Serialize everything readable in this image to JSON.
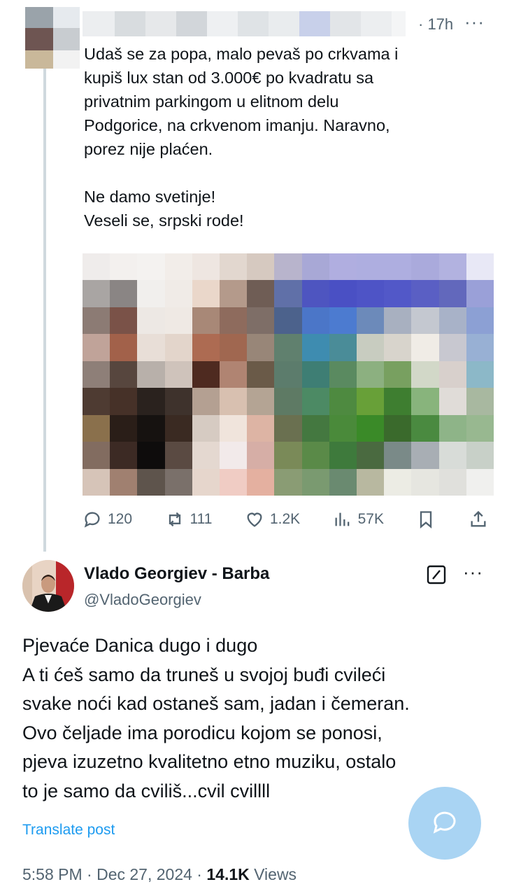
{
  "top_tweet": {
    "time": "· 17h",
    "more_icon": "more-horizontal-icon",
    "text": "Udaš se za popa, malo pevaš po crkvama i\nkupiš lux stan od 3.000€ po kvadratu sa\nprivatnim parkingom u elitnom delu\nPodgorice, na crkvenom imanju. Naravno,\nporez nije plaćen.\n\nNe damo svetinje!\nVeseli se, srpski rode!",
    "actions": {
      "replies": "120",
      "reposts": "111",
      "likes": "1.2K",
      "views": "57K"
    }
  },
  "reply": {
    "name": "Vlado Georgiev - Barba",
    "handle": "@VladoGeorgiev",
    "text": "Pjevaće Danica dugo i dugo\nA ti ćeš samo da truneš u svojoj buđi cvileći\nsvake noći kad ostaneš sam, jadan i čemeran.\nOvo čeljade ima porodicu kojom se ponosi,\npjeva izuzetno kvalitetno etno muziku, ostalo\nto je samo da cviliš...cvil cvillll",
    "translate": "Translate post",
    "time_date": "5:58 PM · Dec 27, 2024 · ",
    "views_count": "14.1K",
    "views_label": " Views"
  },
  "colors": {
    "accent": "#1d9bf0",
    "muted": "#536471",
    "fab": "#a9d4f3"
  }
}
